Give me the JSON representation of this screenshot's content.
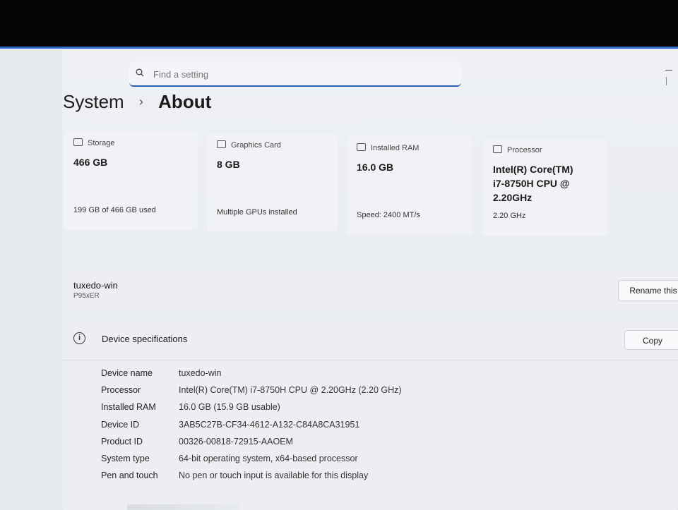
{
  "search": {
    "placeholder": "Find a setting"
  },
  "breadcrumb": {
    "parent": "System",
    "separator": "›",
    "current": "About"
  },
  "cards": [
    {
      "icon": "storage-icon",
      "header": "Storage",
      "value": "466 GB",
      "sub": "199 GB of 466 GB used"
    },
    {
      "icon": "graphics-card-icon",
      "header": "Graphics Card",
      "value": "8 GB",
      "sub": "Multiple GPUs installed"
    },
    {
      "icon": "ram-icon",
      "header": "Installed RAM",
      "value": "16.0 GB",
      "sub": "Speed: 2400 MT/s"
    },
    {
      "icon": "processor-icon",
      "header": "Processor",
      "value": "Intel(R) Core(TM) i7-8750H CPU @ 2.20GHz",
      "sub": "2.20 GHz"
    }
  ],
  "device": {
    "name": "tuxedo-win",
    "model": "P95xER",
    "rename_label": "Rename this"
  },
  "specs": {
    "title": "Device specifications",
    "copy_label": "Copy",
    "rows": [
      {
        "key": "Device name",
        "value": "tuxedo-win"
      },
      {
        "key": "Processor",
        "value": "Intel(R) Core(TM) i7-8750H CPU @ 2.20GHz (2.20 GHz)"
      },
      {
        "key": "Installed RAM",
        "value": "16.0 GB (15.9 GB usable)"
      },
      {
        "key": "Device ID",
        "value": "3AB5C27B-CF34-4612-A132-C84A8CA31951"
      },
      {
        "key": "Product ID",
        "value": "00326-00818-72915-AAOEM"
      },
      {
        "key": "System type",
        "value": "64-bit operating system, x64-based processor"
      },
      {
        "key": "Pen and touch",
        "value": "No pen or touch input is available for this display"
      }
    ]
  },
  "colors": {
    "accent": "#2e5fb8",
    "page_bg": "#eef0f4",
    "card_bg": "#f0f2f5"
  }
}
